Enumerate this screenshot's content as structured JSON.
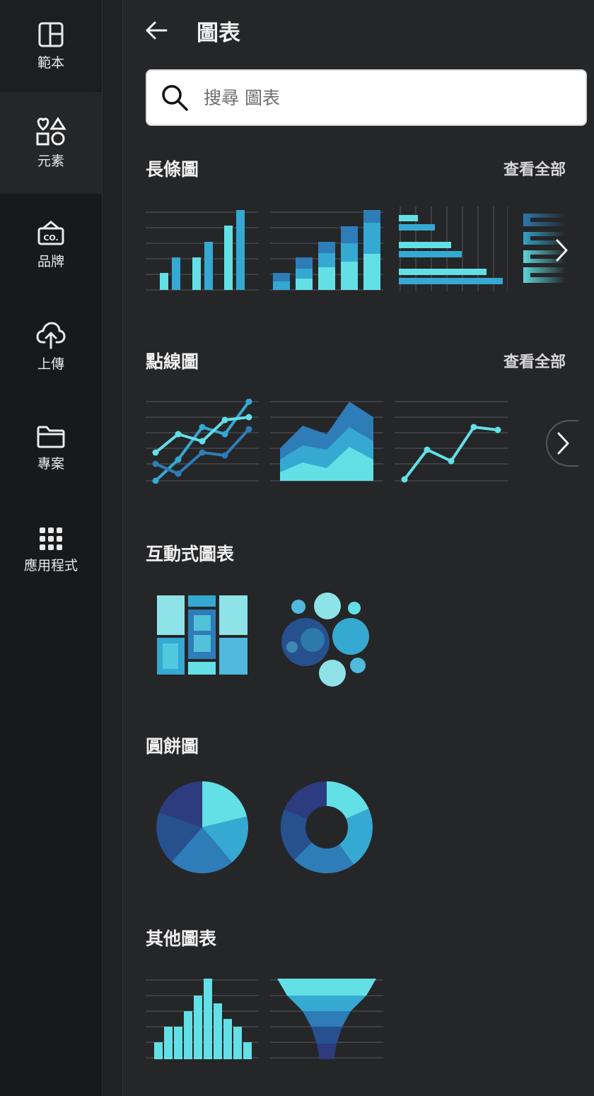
{
  "rail": {
    "items": [
      {
        "label": "範本",
        "icon": "template-icon"
      },
      {
        "label": "元素",
        "icon": "elements-icon"
      },
      {
        "label": "品牌",
        "icon": "brand-icon"
      },
      {
        "label": "上傳",
        "icon": "upload-icon"
      },
      {
        "label": "專案",
        "icon": "folder-icon"
      },
      {
        "label": "應用程式",
        "icon": "apps-grid-icon"
      }
    ]
  },
  "header": {
    "title": "圖表",
    "back_icon": "arrow-left-icon"
  },
  "search": {
    "placeholder": "搜尋 圖表",
    "value": ""
  },
  "sections": {
    "bar": {
      "title": "長條圖",
      "see_all": "查看全部"
    },
    "line": {
      "title": "點線圖",
      "see_all": "查看全部"
    },
    "interactive": {
      "title": "互動式圖表"
    },
    "pie": {
      "title": "圓餅圖"
    },
    "other": {
      "title": "其他圖表"
    }
  },
  "colors": {
    "cyan": "#62e0e6",
    "teal": "#35a9d2",
    "blue": "#2e7cb8",
    "navy": "#27508f",
    "indigo": "#2c3c7e",
    "grid": "#3d3f44"
  }
}
